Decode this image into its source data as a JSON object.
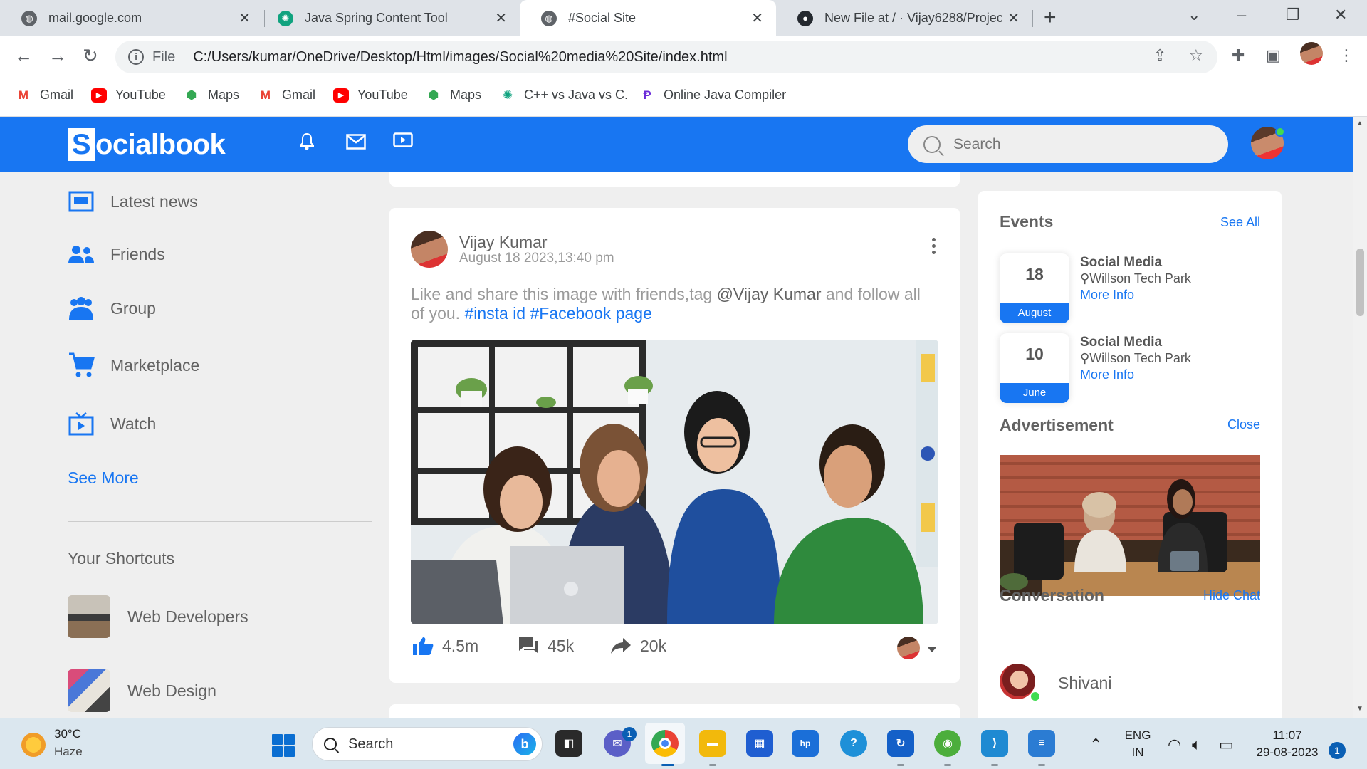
{
  "browser": {
    "tabs": [
      {
        "title": "mail.google.com",
        "icon": "globe-icon"
      },
      {
        "title": "Java Spring Content Tool",
        "icon": "chatgpt-icon"
      },
      {
        "title": "#Social Site",
        "icon": "globe-icon",
        "active": true
      },
      {
        "title": "New File at / · Vijay6288/Project_",
        "icon": "github-icon"
      }
    ],
    "address_prefix": "File",
    "url": "C:/Users/kumar/OneDrive/Desktop/Html/images/Social%20media%20Site/index.html",
    "bookmarks": [
      {
        "label": "Gmail",
        "icon": "gmail-icon",
        "color": "#ea4335"
      },
      {
        "label": "YouTube",
        "icon": "youtube-icon",
        "color": "#ff0000"
      },
      {
        "label": "Maps",
        "icon": "maps-icon",
        "color": "#34a853"
      },
      {
        "label": "Gmail",
        "icon": "gmail-icon",
        "color": "#ea4335"
      },
      {
        "label": "YouTube",
        "icon": "youtube-icon",
        "color": "#ff0000"
      },
      {
        "label": "Maps",
        "icon": "maps-icon",
        "color": "#34a853"
      },
      {
        "label": "C++ vs Java vs C.",
        "icon": "chatgpt-icon",
        "color": "#10a37f"
      },
      {
        "label": "Online Java Compiler",
        "icon": "compiler-icon",
        "color": "#6a2bd9"
      }
    ]
  },
  "site": {
    "brand_color": "#1876f2",
    "logo_letter": "S",
    "logo_rest": "ocialbook",
    "search_placeholder": "Search",
    "nav_icons": [
      "bell-icon",
      "mail-icon",
      "video-icon"
    ]
  },
  "left_sidebar": {
    "items": [
      {
        "label": "Latest news",
        "icon": "news-icon"
      },
      {
        "label": "Friends",
        "icon": "friends-icon"
      },
      {
        "label": "Group",
        "icon": "group-icon"
      },
      {
        "label": "Marketplace",
        "icon": "cart-icon"
      },
      {
        "label": "Watch",
        "icon": "watch-icon"
      }
    ],
    "see_more": "See More",
    "shortcuts_title": "Your Shortcuts",
    "shortcuts": [
      {
        "label": "Web Developers"
      },
      {
        "label": "Web Design"
      }
    ]
  },
  "post": {
    "author": "Vijay Kumar",
    "date": "August 18 2023,13:40 pm",
    "text_before": "Like and share this image with friends,tag ",
    "mention": "@Vijay Kumar",
    "text_middle": " and follow all of you. ",
    "hashtag1": "#insta id",
    "hashtag2": "#Facebook page",
    "likes": "4.5m",
    "comments": "45k",
    "shares": "20k"
  },
  "right_sidebar": {
    "events_title": "Events",
    "events_link": "See All",
    "events": [
      {
        "day": "18",
        "month": "August",
        "title": "Social Media",
        "location": "Willson Tech Park",
        "more": "More Info"
      },
      {
        "day": "10",
        "month": "June",
        "title": "Social Media",
        "location": "Willson Tech Park",
        "more": "More Info"
      }
    ],
    "ad_title": "Advertisement",
    "ad_link": "Close",
    "conversation_title": "Conversation",
    "conversation_link": "Hide Chat",
    "chats": [
      {
        "name": "Shivani",
        "online": true
      }
    ]
  },
  "taskbar": {
    "temperature": "30°C",
    "weather": "Haze",
    "search_label": "Search",
    "language": "ENG",
    "region": "IN",
    "time": "11:07",
    "date": "29-08-2023",
    "notifications": "1",
    "teams_badge": "1"
  }
}
